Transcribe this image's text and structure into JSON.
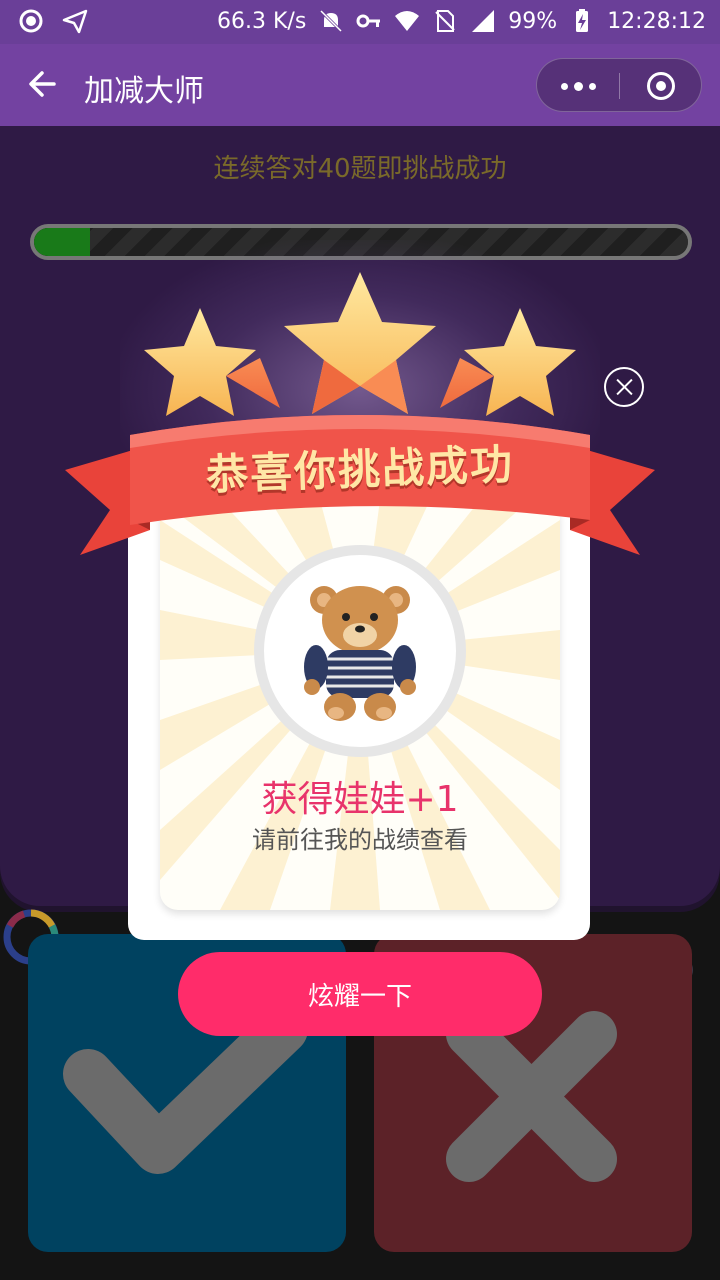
{
  "status_bar": {
    "speed": "66.3 K/s",
    "battery": "99%",
    "time": "12:28:12"
  },
  "title_bar": {
    "title": "加减大师"
  },
  "game": {
    "challenge_text": "连续答对40题即挑战成功",
    "progress_fraction": 0.085
  },
  "modal": {
    "ribbon_text": "恭喜你挑战成功",
    "prize_text": "获得娃娃+1",
    "prize_sub": "请前往我的战绩查看",
    "share_label": "炫耀一下"
  },
  "colors": {
    "accent": "#ff2c6a",
    "header": "#7342a1",
    "correct": "#004260",
    "wrong": "#5c2228"
  }
}
